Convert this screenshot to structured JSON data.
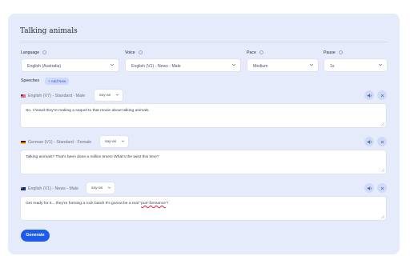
{
  "title": "Talking animals",
  "fields": {
    "language": {
      "label": "Language",
      "value": "English (Australia)"
    },
    "voice": {
      "label": "Voice",
      "value": "English (V1) - News - Male"
    },
    "pace": {
      "label": "Pace",
      "value": "Medium"
    },
    "pause": {
      "label": "Pause",
      "value": "1s"
    }
  },
  "speeches": {
    "label": "Speeches",
    "add_label": "+ Add New",
    "items": [
      {
        "flag": "flag-us-icon",
        "voice": "English (V7) - Standard - Male",
        "say_as": "say-as",
        "text": "So, I heard they're making a sequel to that movie about talking animals."
      },
      {
        "flag": "flag-de-icon",
        "voice": "German (V1) - Standard - Female",
        "say_as": "say-as",
        "text": "Talking animals? That's been done a million times! What's the twist this time?"
      },
      {
        "flag": "flag-au-icon",
        "voice": "English (V1) - News - Male",
        "say_as": "say-as",
        "text_before": "Get ready for it... they're forming a rock band! It's gonna be a real \"",
        "text_spell": "purr-formance",
        "text_after": "\"!"
      }
    ]
  },
  "generate_label": "Generate",
  "colors": {
    "accent": "#1d5bea",
    "card_bg": "#e6ebfb",
    "chip_bg": "#cfd9fa"
  }
}
